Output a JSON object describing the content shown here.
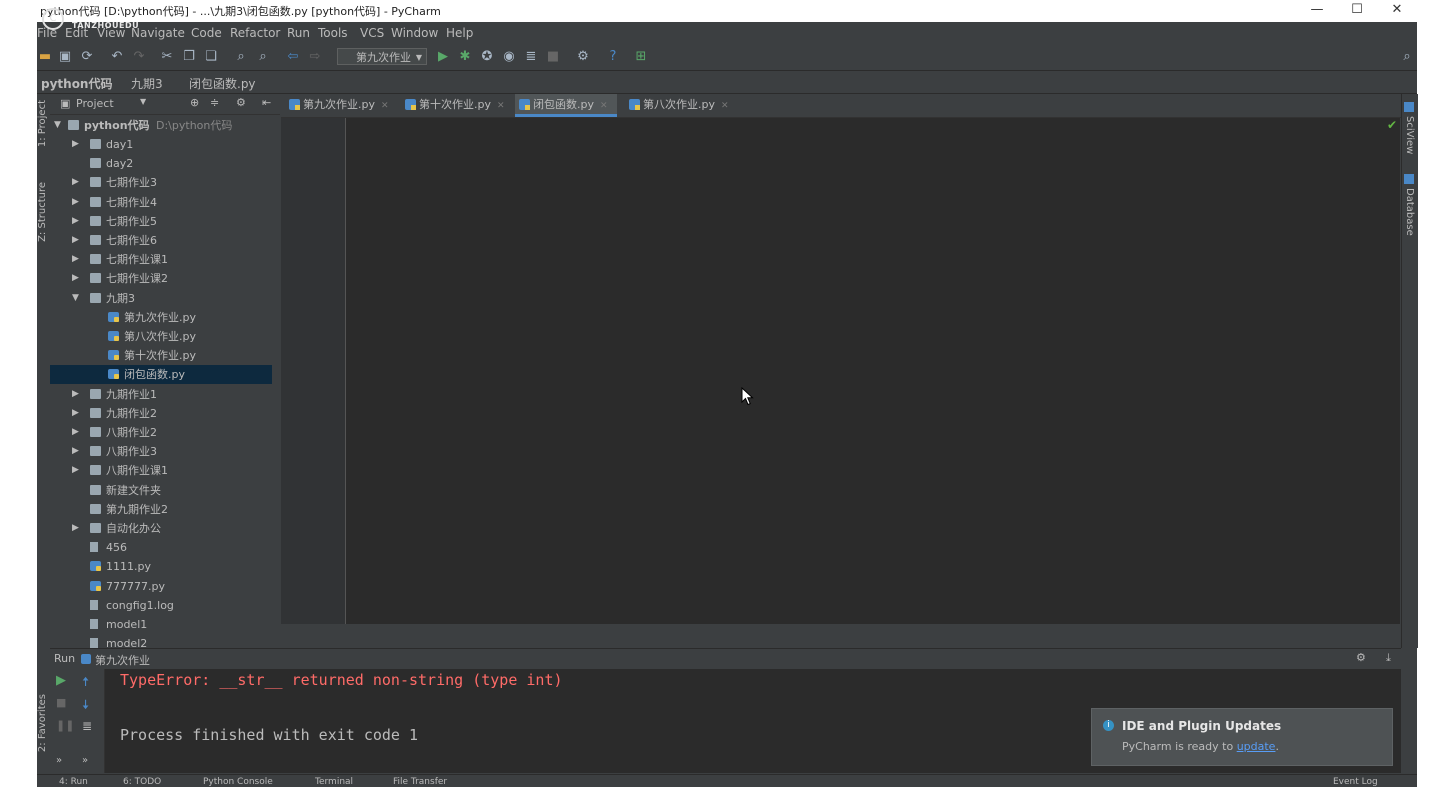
{
  "window": {
    "title": "python代码 [D:\\python代码] - ...\\九期3\\闭包函数.py [python代码] - PyCharm",
    "minimize": "—",
    "maximize": "☐",
    "close": "✕"
  },
  "watermark": {
    "text": "TANZHOUEDU",
    "glyph": "C"
  },
  "menu": [
    "File",
    "Edit",
    "View",
    "Navigate",
    "Code",
    "Refactor",
    "Run",
    "Tools",
    "VCS",
    "Window",
    "Help"
  ],
  "toolbar": {
    "run_config": "第九次作业"
  },
  "breadcrumb": [
    "python代码",
    "九期3",
    "闭包函数.py"
  ],
  "left_strip": {
    "project": "1: Project",
    "structure": "Z: Structure",
    "favorites": "2: Favorites"
  },
  "project_pane": {
    "header": "Project",
    "root": {
      "name": "python代码",
      "path": "D:\\python代码"
    },
    "items": [
      {
        "label": "day1",
        "type": "folder",
        "depth": 1,
        "arrow": "▶"
      },
      {
        "label": "day2",
        "type": "folder",
        "depth": 1,
        "arrow": ""
      },
      {
        "label": "七期作业3",
        "type": "folder",
        "depth": 1,
        "arrow": "▶"
      },
      {
        "label": "七期作业4",
        "type": "folder",
        "depth": 1,
        "arrow": "▶"
      },
      {
        "label": "七期作业5",
        "type": "folder",
        "depth": 1,
        "arrow": "▶"
      },
      {
        "label": "七期作业6",
        "type": "folder",
        "depth": 1,
        "arrow": "▶"
      },
      {
        "label": "七期作业课1",
        "type": "folder",
        "depth": 1,
        "arrow": "▶"
      },
      {
        "label": "七期作业课2",
        "type": "folder",
        "depth": 1,
        "arrow": "▶"
      },
      {
        "label": "九期3",
        "type": "folder",
        "depth": 1,
        "arrow": "▼"
      },
      {
        "label": "第九次作业.py",
        "type": "py",
        "depth": 2,
        "arrow": ""
      },
      {
        "label": "第八次作业.py",
        "type": "py",
        "depth": 2,
        "arrow": ""
      },
      {
        "label": "第十次作业.py",
        "type": "py",
        "depth": 2,
        "arrow": ""
      },
      {
        "label": "闭包函数.py",
        "type": "py",
        "depth": 2,
        "arrow": "",
        "selected": true
      },
      {
        "label": "九期作业1",
        "type": "folder",
        "depth": 1,
        "arrow": "▶"
      },
      {
        "label": "九期作业2",
        "type": "folder",
        "depth": 1,
        "arrow": "▶"
      },
      {
        "label": "八期作业2",
        "type": "folder",
        "depth": 1,
        "arrow": "▶"
      },
      {
        "label": "八期作业3",
        "type": "folder",
        "depth": 1,
        "arrow": "▶"
      },
      {
        "label": "八期作业课1",
        "type": "folder",
        "depth": 1,
        "arrow": "▶"
      },
      {
        "label": "新建文件夹",
        "type": "folder",
        "depth": 1,
        "arrow": ""
      },
      {
        "label": "第九期作业2",
        "type": "folder",
        "depth": 1,
        "arrow": ""
      },
      {
        "label": "自动化办公",
        "type": "folder",
        "depth": 1,
        "arrow": "▶"
      },
      {
        "label": "456",
        "type": "file",
        "depth": 1,
        "arrow": ""
      },
      {
        "label": "1111.py",
        "type": "py",
        "depth": 1,
        "arrow": ""
      },
      {
        "label": "777777.py",
        "type": "py",
        "depth": 1,
        "arrow": ""
      },
      {
        "label": "congfig1.log",
        "type": "file",
        "depth": 1,
        "arrow": ""
      },
      {
        "label": "model1",
        "type": "file",
        "depth": 1,
        "arrow": ""
      },
      {
        "label": "model2",
        "type": "file",
        "depth": 1,
        "arrow": ""
      }
    ]
  },
  "tabs": [
    {
      "label": "第九次作业.py",
      "active": false
    },
    {
      "label": "第十次作业.py",
      "active": false
    },
    {
      "label": "闭包函数.py",
      "active": true
    },
    {
      "label": "第八次作业.py",
      "active": false
    }
  ],
  "right_strip": {
    "sciview": "SciView",
    "database": "Database"
  },
  "run_panel": {
    "prefix": "Run",
    "config": "第九次作业",
    "error_line": "TypeError: __str__ returned non-string (type int)",
    "exit_line": "Process finished with exit code 1"
  },
  "notification": {
    "title": "IDE and Plugin Updates",
    "body_prefix": "PyCharm is ready to ",
    "link": "update",
    "body_suffix": "."
  },
  "statusbar": {
    "items": [
      "4: Run",
      "6: TODO",
      "Python Console",
      "Terminal",
      "File Transfer"
    ],
    "event_log": "Event Log"
  },
  "colors": {
    "error": "#ff6b68",
    "link": "#589df6",
    "selection": "#0d293e",
    "accent": "#4a88c7"
  }
}
